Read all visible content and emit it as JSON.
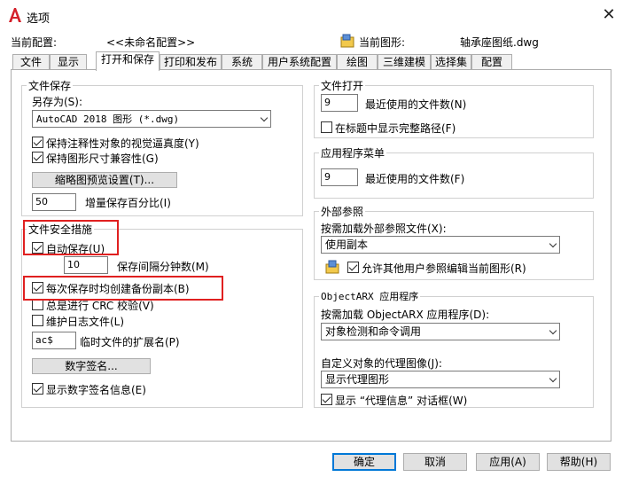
{
  "window": {
    "title": "选项",
    "close": "✕"
  },
  "header": {
    "current_profile_label": "当前配置:",
    "current_profile_value": "<<未命名配置>>",
    "current_drawing_label": "当前图形:",
    "current_drawing_value": "轴承座图纸.dwg"
  },
  "tabs": [
    "文件",
    "显示",
    "打开和保存",
    "打印和发布",
    "系统",
    "用户系统配置",
    "绘图",
    "三维建模",
    "选择集",
    "配置"
  ],
  "active_tab": "打开和保存",
  "file_save": {
    "title": "文件保存",
    "save_as_label": "另存为(S):",
    "save_as_value": "AutoCAD 2018 图形 (*.dwg)",
    "keep_annotative": "保持注释性对象的视觉逼真度(Y)",
    "keep_drawing_size": "保持图形尺寸兼容性(G)",
    "thumbnail_btn": "缩略图预览设置(T)...",
    "incremental_value": "50",
    "incremental_label": "增量保存百分比(I)"
  },
  "file_safety": {
    "title": "文件安全措施",
    "autosave": "自动保存(U)",
    "interval_value": "10",
    "interval_label": "保存间隔分钟数(M)",
    "backup_copy": "每次保存时均创建备份副本(B)",
    "crc_check": "总是进行 CRC 校验(V)",
    "log_file": "维护日志文件(L)",
    "temp_ext_value": "ac$",
    "temp_ext_label": "临时文件的扩展名(P)",
    "digital_sig_btn": "数字签名...",
    "show_sig_info": "显示数字签名信息(E)"
  },
  "file_open": {
    "title": "文件打开",
    "recent_value": "9",
    "recent_label": "最近使用的文件数(N)",
    "full_path": "在标题中显示完整路径(F)"
  },
  "app_menu": {
    "title": "应用程序菜单",
    "recent_value": "9",
    "recent_label": "最近使用的文件数(F)"
  },
  "xref": {
    "title": "外部参照",
    "demand_load_label": "按需加载外部参照文件(X):",
    "demand_load_value": "使用副本",
    "allow_edit": "允许其他用户参照编辑当前图形(R)"
  },
  "objectarx": {
    "title": "ObjectARX 应用程序",
    "demand_load_label": "按需加载 ObjectARX 应用程序(D):",
    "demand_load_value": "对象检测和命令调用",
    "proxy_label": "自定义对象的代理图像(J):",
    "proxy_value": "显示代理图形",
    "show_proxy_dialog": "显示 “代理信息” 对话框(W)"
  },
  "buttons": {
    "ok": "确定",
    "cancel": "取消",
    "apply": "应用(A)",
    "help": "帮助(H)"
  },
  "colors": {
    "highlight": "#e02020",
    "accent": "#0078d7",
    "logo": "#d4202a"
  }
}
